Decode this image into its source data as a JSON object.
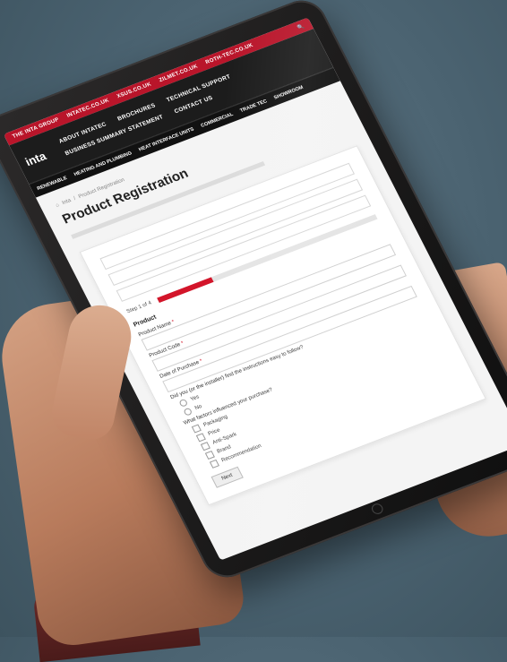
{
  "topbar": {
    "group": "THE INTA GROUP",
    "sites": [
      "INTATEC.CO.UK",
      "XSUS.CO.UK",
      "ZILMET.CO.UK",
      "ROTH-TEC.CO.UK"
    ]
  },
  "header": {
    "logo": "inta",
    "menu_row1": [
      "ABOUT INTATEC",
      "BROCHURES",
      "TECHNICAL SUPPORT"
    ],
    "menu_row2": [
      "BUSINESS SUMMARY STATEMENT",
      "CONTACT US"
    ]
  },
  "subnav": [
    "RENEWABLE",
    "HEATING AND PLUMBING",
    "HEAT INTERFACE UNITS",
    "COMMERCIAL",
    "TRADE TEC",
    "SHOWROOM"
  ],
  "breadcrumb": {
    "home": "Inta",
    "separator": "/",
    "current": "Product Registration"
  },
  "page": {
    "title": "Product Registration"
  },
  "form": {
    "step_label": "Step 1 of 4",
    "progress": 0.25,
    "section": "Product",
    "fields": [
      {
        "label": "Product Name",
        "required": "*"
      },
      {
        "label": "Product Code",
        "required": "*"
      },
      {
        "label": "Date of Purchase",
        "required": "*"
      }
    ],
    "question1": "Did you (or the installer) find the instructions easy to follow?",
    "q1_options": [
      "Yes",
      "No"
    ],
    "question2": "What factors influenced your purchase?",
    "q2_options": [
      "Packaging",
      "Price",
      "Anti-Spark",
      "Brand",
      "Recommendation"
    ],
    "next": "Next"
  },
  "colors": {
    "accent": "#d3152a",
    "header": "#1c1c1c",
    "background": "#4a6270"
  }
}
